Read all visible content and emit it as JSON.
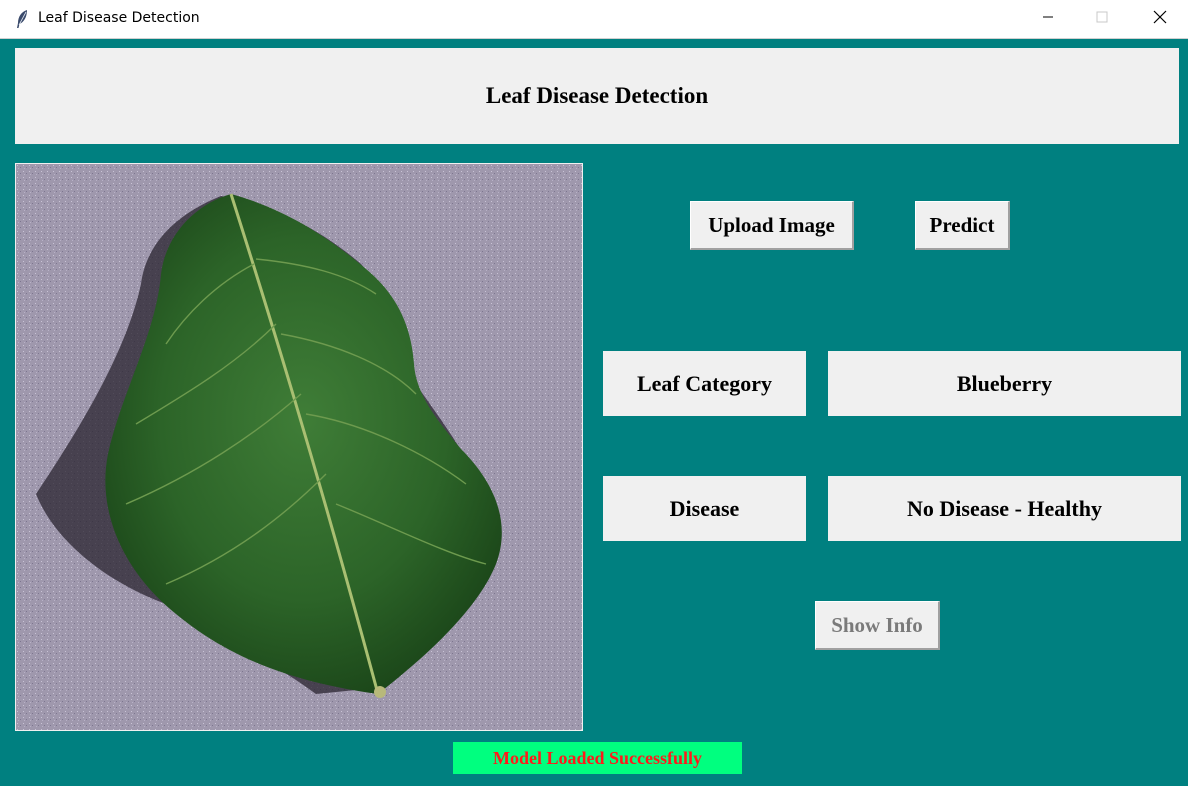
{
  "window": {
    "title": "Leaf Disease Detection",
    "controls": [
      "minimize-icon",
      "maximize-icon",
      "close-icon"
    ]
  },
  "header": {
    "title": "Leaf Disease Detection"
  },
  "image_panel": {
    "icon": "leaf-image",
    "bg_color": "#9e97ad",
    "leaf_color": "#2e6b2a"
  },
  "buttons": {
    "upload": "Upload Image",
    "predict": "Predict",
    "show_info": "Show Info"
  },
  "results": {
    "category_label": "Leaf Category",
    "category_value": "Blueberry",
    "disease_label": "Disease",
    "disease_value": "No Disease - Healthy"
  },
  "status": {
    "text": "Model Loaded Successfully",
    "bg_color": "#00ff7f",
    "text_color": "#ff1a1a"
  },
  "colors": {
    "window_bg": "#008080",
    "panel_bg": "#f0f0f0"
  }
}
